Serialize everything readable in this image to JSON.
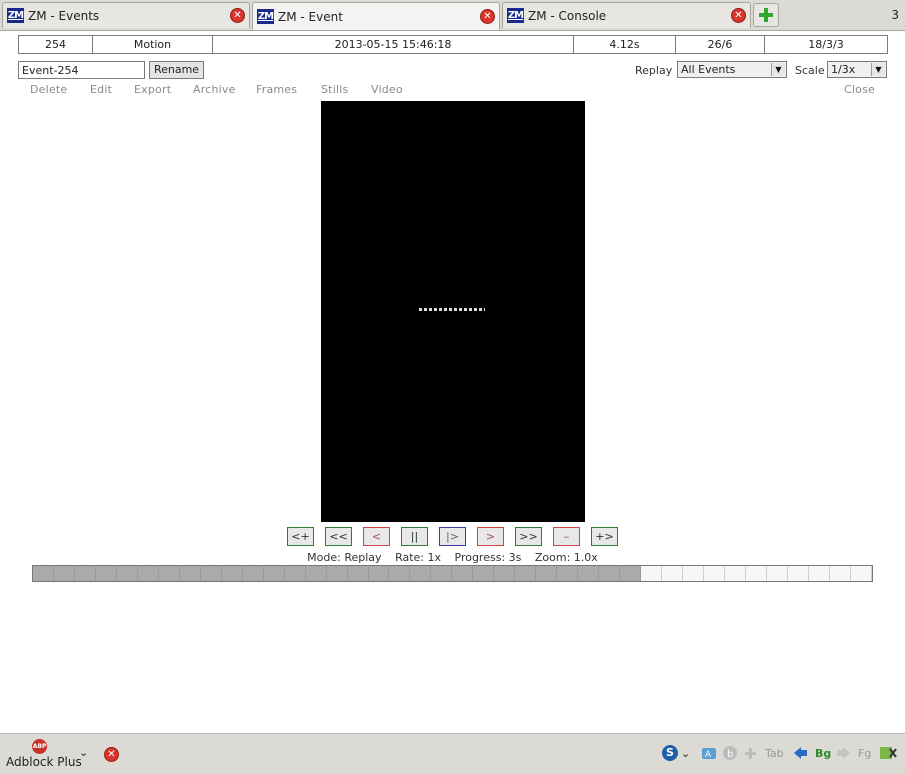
{
  "tabs": [
    {
      "logo": "ZM",
      "title": "ZM - Events",
      "active": false
    },
    {
      "logo": "ZM",
      "title": "ZM - Event",
      "active": true
    },
    {
      "logo": "ZM",
      "title": "ZM - Console",
      "active": false
    }
  ],
  "tab_count": "3",
  "event_info": {
    "id": "254",
    "cause": "Motion",
    "datetime": "2013-05-15 15:46:18",
    "length": "4.12s",
    "frames": "26/6",
    "scores": "18/3/3"
  },
  "event_name": {
    "value": "Event-254",
    "rename_label": "Rename"
  },
  "replay": {
    "label": "Replay",
    "selected": "All Events"
  },
  "scale": {
    "label": "Scale",
    "selected": "1/3x"
  },
  "actions": {
    "delete": "Delete",
    "edit": "Edit",
    "export": "Export",
    "archive": "Archive",
    "frames": "Frames",
    "stills": "Stills",
    "video": "Video",
    "close": "Close"
  },
  "controls": {
    "prev_event": "<+",
    "fast_rev": "<<",
    "slow_rev": "<",
    "pause": "||",
    "step_fwd": "|>",
    "play": ">",
    "fast_fwd": ">>",
    "zoom_out": "–",
    "next_event": "+>"
  },
  "status": {
    "mode": "Mode: Replay",
    "rate": "Rate: 1x",
    "progress": "Progress: 3s",
    "zoom": "Zoom: 1.0x"
  },
  "progress_bar": {
    "segments": 40,
    "completed": 29,
    "fraction": 0.725
  },
  "addon_bar": {
    "adblock_label": "Adblock Plus",
    "adblock_icon_text": "ABP",
    "tab_label": "Tab",
    "bg_label": "Bg",
    "fg_label": "Fg"
  },
  "colors": {
    "zm_logo": "#1a2a8a",
    "close_red": "#d9362b",
    "new_tab_green": "#2ea82e",
    "video_bg": "#000000",
    "progress_done": "#aaaaaa",
    "ctrl_green_border": "#2e7d32",
    "ctrl_red_border": "#d54242",
    "ctrl_blue_border": "#3a3aa8"
  }
}
